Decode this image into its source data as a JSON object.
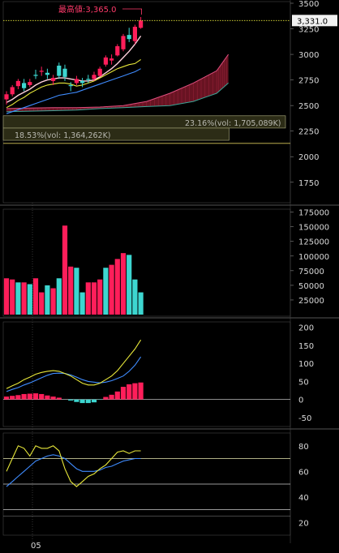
{
  "colors": {
    "background": "#000000",
    "up": "#ff1e5a",
    "down": "#3dd6d0",
    "ma_short": "#ffffff",
    "ma_mid": "#e8e83a",
    "ma_long": "#3f8cff",
    "ichimoku_cloud": "#8b1a2e",
    "current_price_line": "#e8e83a",
    "grid": "#3a3a3a",
    "axis_text": "#d8d8d8"
  },
  "chart_data": [
    {
      "type": "candlestick",
      "panel": "price",
      "y_ticks": [
        "3500",
        "3250",
        "3000",
        "2750",
        "2500",
        "2250",
        "2000",
        "1750"
      ],
      "ylim": [
        1550,
        3500
      ],
      "x_tick": "05",
      "max_label": "最高値:3,365.0",
      "max_value": 3365.0,
      "current_price_label": "3,331.0",
      "current_price": 3331.0,
      "candles": [
        {
          "o": 2560,
          "h": 2640,
          "l": 2510,
          "c": 2610
        },
        {
          "o": 2610,
          "h": 2700,
          "l": 2590,
          "c": 2680
        },
        {
          "o": 2690,
          "h": 2760,
          "l": 2660,
          "c": 2740
        },
        {
          "o": 2720,
          "h": 2760,
          "l": 2640,
          "c": 2670
        },
        {
          "o": 2700,
          "h": 2760,
          "l": 2680,
          "c": 2730
        },
        {
          "o": 2800,
          "h": 2850,
          "l": 2760,
          "c": 2790
        },
        {
          "o": 2830,
          "h": 2880,
          "l": 2790,
          "c": 2840
        },
        {
          "o": 2820,
          "h": 2860,
          "l": 2760,
          "c": 2800
        },
        {
          "o": 2740,
          "h": 2800,
          "l": 2700,
          "c": 2770
        },
        {
          "o": 2890,
          "h": 2920,
          "l": 2760,
          "c": 2790
        },
        {
          "o": 2860,
          "h": 2900,
          "l": 2740,
          "c": 2780
        },
        {
          "o": 2700,
          "h": 2730,
          "l": 2640,
          "c": 2690
        },
        {
          "o": 2720,
          "h": 2790,
          "l": 2700,
          "c": 2760
        },
        {
          "o": 2740,
          "h": 2770,
          "l": 2680,
          "c": 2720
        },
        {
          "o": 2760,
          "h": 2800,
          "l": 2720,
          "c": 2750
        },
        {
          "o": 2760,
          "h": 2830,
          "l": 2740,
          "c": 2800
        },
        {
          "o": 2790,
          "h": 2880,
          "l": 2780,
          "c": 2860
        },
        {
          "o": 2900,
          "h": 2990,
          "l": 2880,
          "c": 2970
        },
        {
          "o": 2940,
          "h": 3000,
          "l": 2900,
          "c": 2960
        },
        {
          "o": 2990,
          "h": 3100,
          "l": 2980,
          "c": 3080
        },
        {
          "o": 3050,
          "h": 3200,
          "l": 3030,
          "c": 3180
        },
        {
          "o": 3190,
          "h": 3260,
          "l": 3120,
          "c": 3150
        },
        {
          "o": 3130,
          "h": 3290,
          "l": 3100,
          "c": 3270
        },
        {
          "o": 3260,
          "h": 3365,
          "l": 3250,
          "c": 3331
        }
      ],
      "ma_short": [
        2530,
        2560,
        2600,
        2630,
        2660,
        2700,
        2730,
        2750,
        2760,
        2770,
        2770,
        2760,
        2750,
        2740,
        2740,
        2750,
        2780,
        2820,
        2860,
        2910,
        2970,
        3030,
        3100,
        3180
      ],
      "ma_mid": [
        2480,
        2510,
        2550,
        2580,
        2620,
        2650,
        2680,
        2700,
        2710,
        2720,
        2720,
        2710,
        2690,
        2700,
        2720,
        2740,
        2770,
        2800,
        2830,
        2860,
        2880,
        2900,
        2910,
        2950
      ],
      "ma_long": [
        2420,
        2440,
        2460,
        2480,
        2500,
        2520,
        2540,
        2560,
        2580,
        2600,
        2610,
        2620,
        2630,
        2650,
        2670,
        2690,
        2710,
        2730,
        2750,
        2770,
        2790,
        2810,
        2830,
        2860
      ],
      "cloud_x": [
        0,
        4,
        8,
        12,
        16,
        20,
        24,
        28,
        32,
        36,
        38
      ],
      "cloud_a": [
        2470,
        2475,
        2480,
        2480,
        2485,
        2500,
        2540,
        2620,
        2720,
        2840,
        3000
      ],
      "cloud_b": [
        2440,
        2445,
        2450,
        2455,
        2470,
        2480,
        2490,
        2500,
        2540,
        2620,
        2720
      ],
      "volume_profile": [
        {
          "label": "23.16%(vol: 1,705,089K)",
          "percent": 23.16,
          "y_low": 2280,
          "y_high": 2400
        },
        {
          "label": "18.53%(vol: 1,364,262K)",
          "percent": 18.53,
          "y_low": 2160,
          "y_high": 2280
        }
      ],
      "support_line": 2130
    },
    {
      "type": "bar",
      "panel": "volume",
      "y_ticks": [
        "175000",
        "150000",
        "125000",
        "100000",
        "75000",
        "50000",
        "25000"
      ],
      "ylim": [
        0,
        180000
      ],
      "values": [
        62000,
        60000,
        55000,
        55000,
        52000,
        62000,
        38000,
        50000,
        45000,
        62000,
        152000,
        82000,
        80000,
        38000,
        55000,
        55000,
        60000,
        80000,
        85000,
        95000,
        105000,
        102000,
        60000,
        38000
      ],
      "up": [
        true,
        true,
        false,
        true,
        false,
        true,
        true,
        false,
        true,
        false,
        true,
        true,
        false,
        false,
        true,
        true,
        true,
        false,
        true,
        true,
        true,
        false,
        false,
        false
      ]
    },
    {
      "type": "macd",
      "panel": "macd",
      "y_ticks": [
        "200",
        "150",
        "100",
        "50",
        "0",
        "-50"
      ],
      "ylim": [
        -75,
        215
      ],
      "macd": [
        30,
        38,
        45,
        55,
        62,
        70,
        75,
        78,
        80,
        78,
        72,
        65,
        55,
        45,
        40,
        40,
        45,
        55,
        65,
        80,
        100,
        120,
        140,
        165
      ],
      "signal": [
        22,
        28,
        33,
        40,
        46,
        53,
        60,
        67,
        72,
        73,
        72,
        68,
        62,
        55,
        50,
        48,
        46,
        48,
        52,
        58,
        65,
        78,
        95,
        118
      ],
      "histogram": [
        8,
        10,
        12,
        15,
        16,
        17,
        15,
        11,
        8,
        5,
        0,
        -3,
        -7,
        -10,
        -10,
        -8,
        -1,
        7,
        13,
        22,
        35,
        42,
        45,
        47
      ]
    },
    {
      "type": "line",
      "panel": "stochastic",
      "y_ticks": [
        "80",
        "60",
        "40",
        "20"
      ],
      "ylim": [
        10,
        90
      ],
      "hlines": [
        70,
        50,
        30
      ],
      "k": [
        60,
        70,
        80,
        78,
        72,
        80,
        78,
        78,
        80,
        76,
        62,
        52,
        48,
        52,
        56,
        58,
        62,
        65,
        70,
        75,
        76,
        74,
        76,
        76
      ],
      "d": [
        48,
        52,
        56,
        60,
        64,
        68,
        70,
        72,
        73,
        72,
        70,
        66,
        62,
        60,
        60,
        60,
        61,
        63,
        64,
        66,
        68,
        69,
        70,
        70
      ]
    }
  ]
}
